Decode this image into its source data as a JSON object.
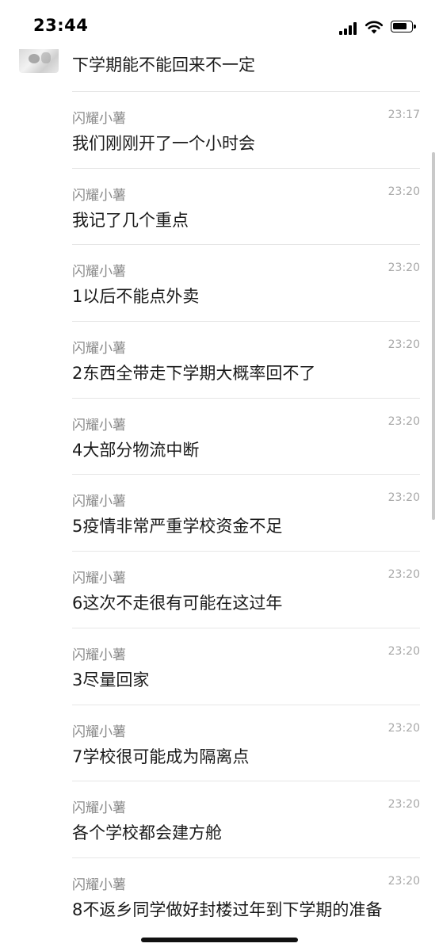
{
  "status": {
    "time": "23:44",
    "battery_level": 0.85
  },
  "chat": {
    "first_text": "下学期能不能回来不一定",
    "messages": [
      {
        "sender": "闪耀小薯",
        "time": "23:17",
        "text": "我们刚刚开了一个小时会"
      },
      {
        "sender": "闪耀小薯",
        "time": "23:20",
        "text": "我记了几个重点"
      },
      {
        "sender": "闪耀小薯",
        "time": "23:20",
        "text": "1以后不能点外卖"
      },
      {
        "sender": "闪耀小薯",
        "time": "23:20",
        "text": "2东西全带走下学期大概率回不了"
      },
      {
        "sender": "闪耀小薯",
        "time": "23:20",
        "text": "4大部分物流中断"
      },
      {
        "sender": "闪耀小薯",
        "time": "23:20",
        "text": "5疫情非常严重学校资金不足"
      },
      {
        "sender": "闪耀小薯",
        "time": "23:20",
        "text": "6这次不走很有可能在这过年"
      },
      {
        "sender": "闪耀小薯",
        "time": "23:20",
        "text": "3尽量回家"
      },
      {
        "sender": "闪耀小薯",
        "time": "23:20",
        "text": "7学校很可能成为隔离点"
      },
      {
        "sender": "闪耀小薯",
        "time": "23:20",
        "text": "各个学校都会建方舱"
      },
      {
        "sender": "闪耀小薯",
        "time": "23:20",
        "text": "8不返乡同学做好封楼过年到下学期的准备"
      }
    ]
  }
}
